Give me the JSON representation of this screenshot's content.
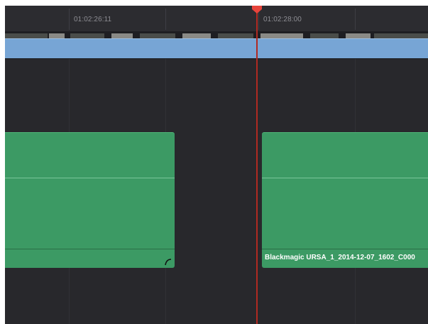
{
  "ruler": {
    "timecodes": [
      "01:02:26:11",
      "01:02:28:00"
    ]
  },
  "tracks": {
    "audio_clips": [
      {
        "name": ""
      },
      {
        "name": "Blackmagic URSA_1_2014-12-07_1602_C000"
      }
    ]
  },
  "icons": [
    "fade-handle-icon",
    "playhead-marker-icon"
  ],
  "colors": {
    "background": "#28282c",
    "video_clip": "#77a5d5",
    "audio_clip": "#3c9a64",
    "playhead": "#b12a22"
  }
}
